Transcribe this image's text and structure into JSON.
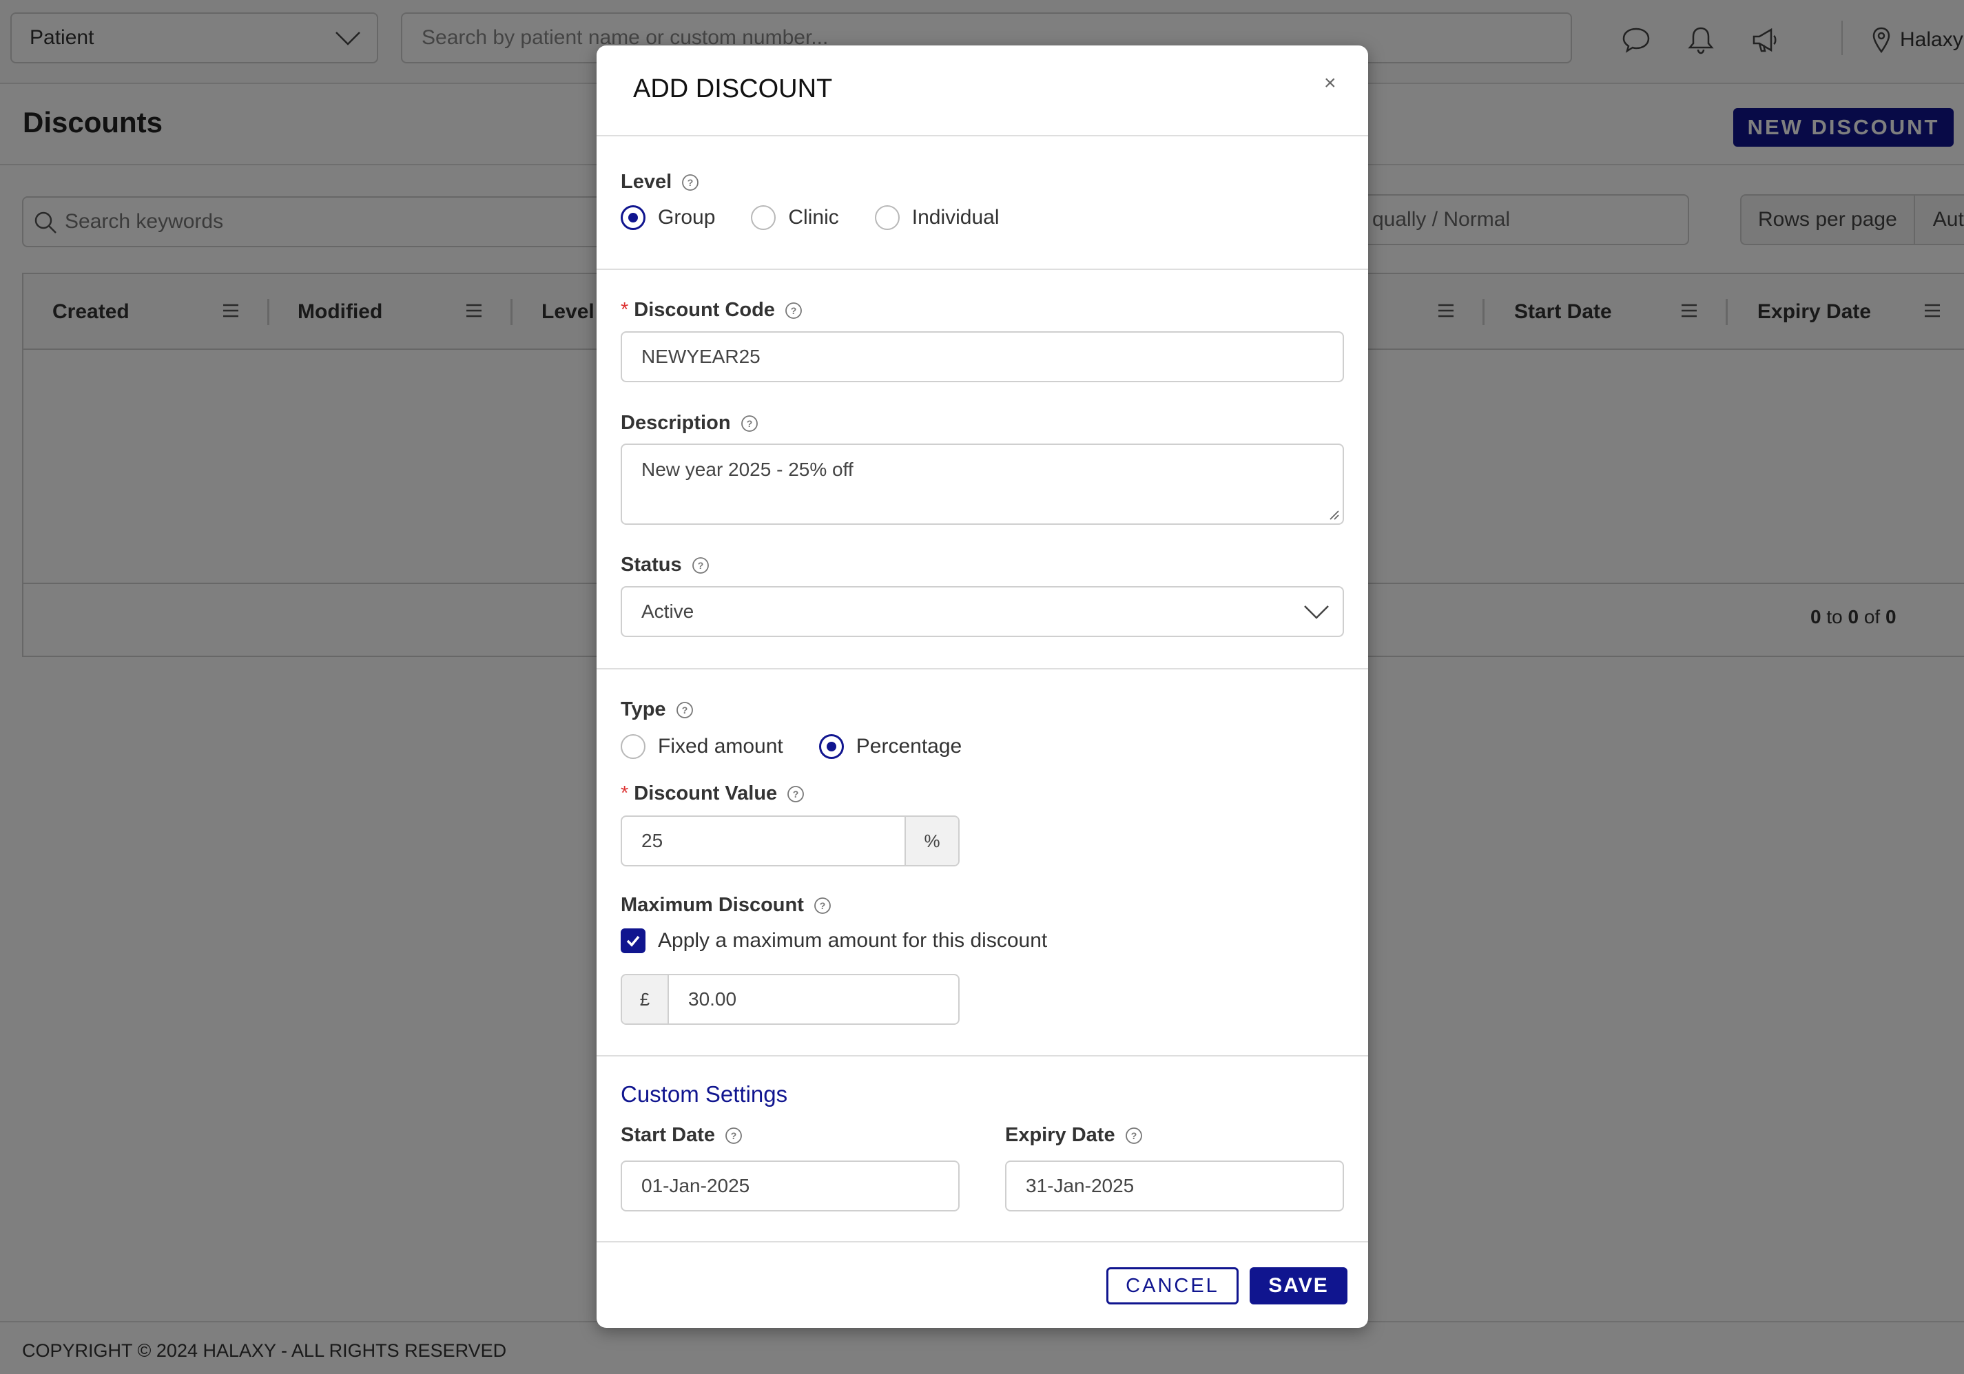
{
  "topbar": {
    "patient_select": "Patient",
    "search_placeholder": "Search by patient name or custom number...",
    "location": "Halaxy"
  },
  "page": {
    "title": "Discounts",
    "new_button": "NEW DISCOUNT",
    "keyword_placeholder": "Search keywords",
    "filter_value": "qually / Normal",
    "rows_label": "Rows per page",
    "rows_value": "Auto"
  },
  "table": {
    "columns": [
      "Created",
      "Modified",
      "Level",
      "Start Date",
      "Expiry Date"
    ],
    "pager": {
      "from": "0",
      "to_word": "to",
      "to": "0",
      "of_word": "of",
      "total": "0"
    }
  },
  "footer": {
    "copyright": "COPYRIGHT © 2024 HALAXY - ALL RIGHTS RESERVED"
  },
  "modal": {
    "title": "ADD DISCOUNT",
    "close": "×",
    "level": {
      "label": "Level",
      "options": [
        "Group",
        "Clinic",
        "Individual"
      ],
      "selected": "Group"
    },
    "discount_code": {
      "label": "Discount Code",
      "value": "NEWYEAR25",
      "required": true
    },
    "description": {
      "label": "Description",
      "value": "New year 2025 - 25% off"
    },
    "status": {
      "label": "Status",
      "value": "Active"
    },
    "type": {
      "label": "Type",
      "options": [
        "Fixed amount",
        "Percentage"
      ],
      "selected": "Percentage"
    },
    "discount_value": {
      "label": "Discount Value",
      "value": "25",
      "suffix": "%",
      "required": true
    },
    "maximum_discount": {
      "label": "Maximum Discount",
      "checkbox_label": "Apply a maximum amount for this discount",
      "checked": true,
      "currency": "£",
      "value": "30.00"
    },
    "custom_settings": {
      "heading": "Custom Settings",
      "start_date": {
        "label": "Start Date",
        "value": "01-Jan-2025"
      },
      "expiry_date": {
        "label": "Expiry Date",
        "value": "31-Jan-2025"
      }
    },
    "buttons": {
      "cancel": "CANCEL",
      "save": "SAVE"
    }
  },
  "colors": {
    "accent": "#10158f",
    "required": "#d33333"
  }
}
